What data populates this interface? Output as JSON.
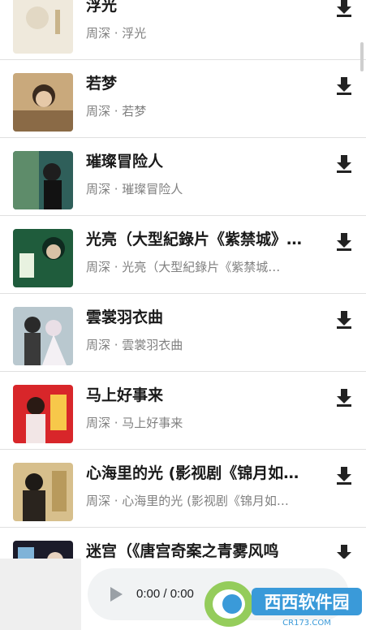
{
  "songs": [
    {
      "title": "浮光",
      "subtitle": "周深 · 浮光",
      "art": "cream"
    },
    {
      "title": "若梦",
      "subtitle": "周深 · 若梦",
      "art": "beige"
    },
    {
      "title": "璀璨冒险人",
      "subtitle": "周深 · 璀璨冒险人",
      "art": "teal"
    },
    {
      "title": "光亮（大型紀錄片《紫禁城》…",
      "subtitle": "周深 · 光亮（大型紀錄片《紫禁城…",
      "art": "green"
    },
    {
      "title": "雲裳羽衣曲",
      "subtitle": "周深 · 雲裳羽衣曲",
      "art": "light"
    },
    {
      "title": "马上好事来",
      "subtitle": "周深 · 马上好事来",
      "art": "red"
    },
    {
      "title": "心海里的光 (影视剧《锦月如…",
      "subtitle": "周深 · 心海里的光 (影视剧《锦月如…",
      "art": "gold"
    },
    {
      "title": "迷宫（《唐宫奇案之青雾风鸣",
      "subtitle": "",
      "art": "dark"
    }
  ],
  "player": {
    "time": "0:00 / 0:00"
  },
  "watermark": {
    "text": "西西软件园",
    "url": "CR173.COM"
  }
}
